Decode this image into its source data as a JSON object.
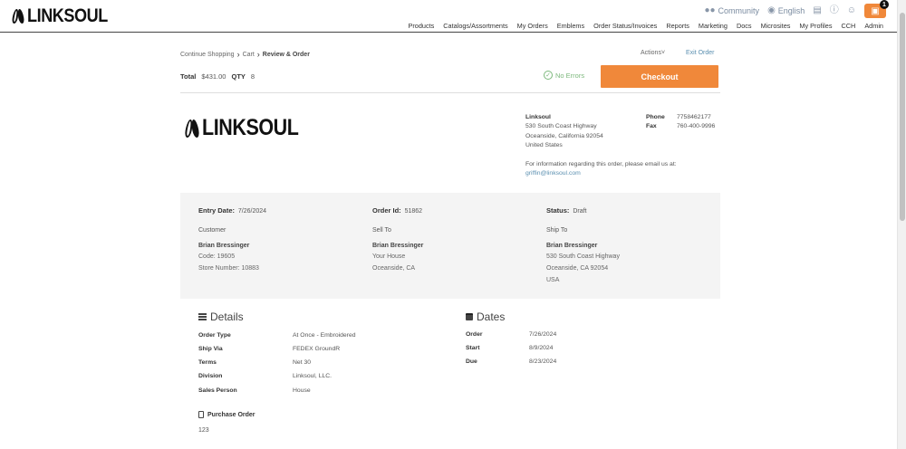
{
  "brand": {
    "name": "LINKSOUL"
  },
  "utility": {
    "community": "Community",
    "language": "English",
    "cart_count": "1"
  },
  "nav": [
    "Products",
    "Catalogs/Assortments",
    "My Orders",
    "Emblems",
    "Order Status/Invoices",
    "Reports",
    "Marketing",
    "Docs",
    "Microsites",
    "My Profiles",
    "CCH",
    "Admin"
  ],
  "breadcrumb": {
    "items": [
      "Continue Shopping",
      "Cart",
      "Review & Order"
    ]
  },
  "actions_label": "Actions",
  "exit_label": "Exit Order",
  "totals": {
    "total_label": "Total",
    "total_value": "$431.00",
    "qty_label": "QTY",
    "qty_value": "8"
  },
  "status_check": "No Errors",
  "checkout_label": "Checkout",
  "company": {
    "name": "Linksoul",
    "address1": "530 South Coast Highway",
    "address2": "Oceanside, California 92054",
    "country": "United States",
    "phone_label": "Phone",
    "phone": "7758462177",
    "fax_label": "Fax",
    "fax": "760-400-9996",
    "note": "For information regarding this order, please email us at:",
    "email": "griffin@linksoul.com"
  },
  "order": {
    "entry_date_label": "Entry Date:",
    "entry_date": "7/26/2024",
    "order_id_label": "Order Id:",
    "order_id": "51862",
    "status_label": "Status:",
    "status": "Draft",
    "customer": {
      "heading": "Customer",
      "name": "Brian Bressinger",
      "code": "Code:  19605",
      "store": "Store Number: 10883"
    },
    "sell_to": {
      "heading": "Sell To",
      "name": "Brian Bressinger",
      "line1": "Your House",
      "line2": "Oceanside, CA"
    },
    "ship_to": {
      "heading": "Ship To",
      "name": "Brian Bressinger",
      "line1": "530 South Coast Highway",
      "line2": "Oceanside, CA 92054",
      "line3": "USA"
    }
  },
  "details": {
    "title": "Details",
    "rows": [
      {
        "label": "Order Type",
        "value": "At Once - Embroidered"
      },
      {
        "label": "Ship Via",
        "value": "FEDEX GroundR"
      },
      {
        "label": "Terms",
        "value": "Net 30"
      },
      {
        "label": "Division",
        "value": "Linksoul, LLC."
      },
      {
        "label": "Sales Person",
        "value": "House"
      }
    ]
  },
  "dates": {
    "title": "Dates",
    "rows": [
      {
        "label": "Order",
        "value": "7/26/2024"
      },
      {
        "label": "Start",
        "value": "8/9/2024"
      },
      {
        "label": "Due",
        "value": "8/23/2024"
      }
    ]
  },
  "purchase_order": {
    "label": "Purchase Order",
    "value": "123"
  },
  "colors": {
    "accent": "#f0883a",
    "link": "#5a8fb0",
    "success": "#7cb87c",
    "panel": "#f4f4f4"
  }
}
